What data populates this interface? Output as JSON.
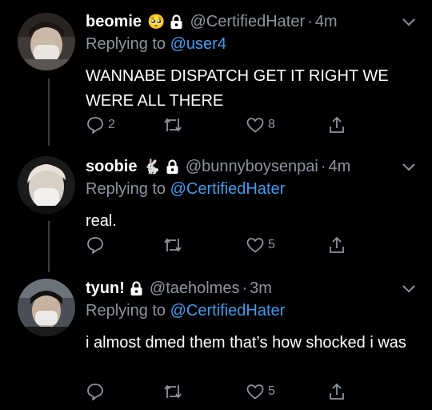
{
  "tweets": [
    {
      "name": "beomie",
      "emoji": "🥺",
      "handle": "@CertifiedHater",
      "separator": "·",
      "time": "4m",
      "replying_prefix": "Replying to",
      "replying_to": "@user4",
      "text": "WANNABE DISPATCH GET IT RIGHT WE WERE ALL THERE",
      "reply_count": "2",
      "retweet_count": "",
      "like_count": "8"
    },
    {
      "name": "soobie",
      "emoji": "🐇",
      "handle": "@bunnyboysenpai",
      "separator": "·",
      "time": "4m",
      "replying_prefix": "Replying to",
      "replying_to": "@CertifiedHater",
      "text": "real.",
      "reply_count": "",
      "retweet_count": "",
      "like_count": "5"
    },
    {
      "name": "tyun!",
      "emoji": "",
      "handle": "@taeholmes",
      "separator": "·",
      "time": "3m",
      "replying_prefix": "Replying to",
      "replying_to": "@CertifiedHater",
      "text": "i almost dmed them that’s how shocked i was",
      "reply_count": "",
      "retweet_count": "",
      "like_count": "5"
    }
  ],
  "icons": {
    "reply": "reply-icon",
    "retweet": "retweet-icon",
    "like": "like-icon",
    "share": "share-icon",
    "lock": "lock-icon",
    "chevron": "chevron-down-icon"
  },
  "colors": {
    "background": "#000000",
    "text": "#ffffff",
    "muted": "#8b959e",
    "mention": "#3e9cef",
    "thread_line": "#3a3d40"
  }
}
